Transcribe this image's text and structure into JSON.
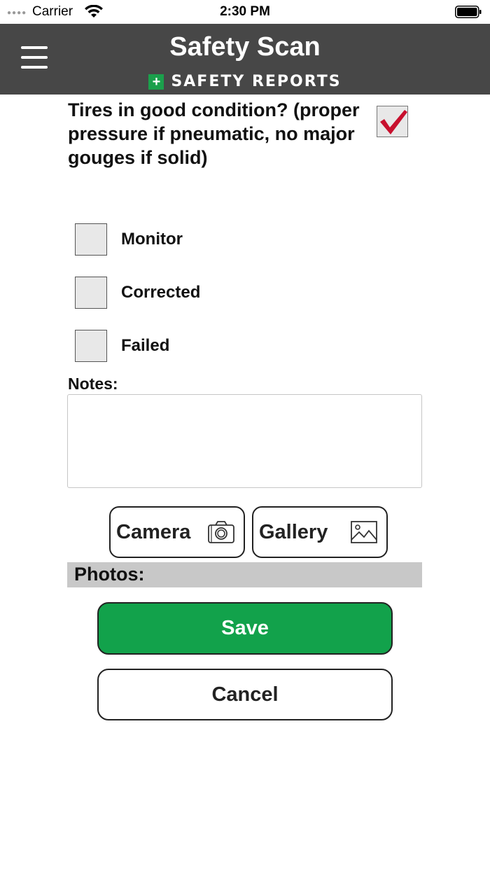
{
  "status_bar": {
    "carrier": "Carrier",
    "time": "2:30 PM"
  },
  "header": {
    "title": "Safety Scan",
    "brand_name": "SAFETY REPORTS"
  },
  "question": {
    "text": "Tires in good condition? (proper pressure if pneumatic, no major gouges if solid)",
    "checked": true
  },
  "options": [
    {
      "label": "Monitor",
      "checked": false
    },
    {
      "label": "Corrected",
      "checked": false
    },
    {
      "label": "Failed",
      "checked": false
    }
  ],
  "notes": {
    "label": "Notes:",
    "value": ""
  },
  "media": {
    "camera_label": "Camera",
    "gallery_label": "Gallery"
  },
  "photos_label": "Photos:",
  "actions": {
    "save_label": "Save",
    "cancel_label": "Cancel"
  },
  "colors": {
    "header_bg": "#474747",
    "save_bg": "#12a24b",
    "check_red": "#c8102e",
    "brand_green": "#1ba04c"
  }
}
